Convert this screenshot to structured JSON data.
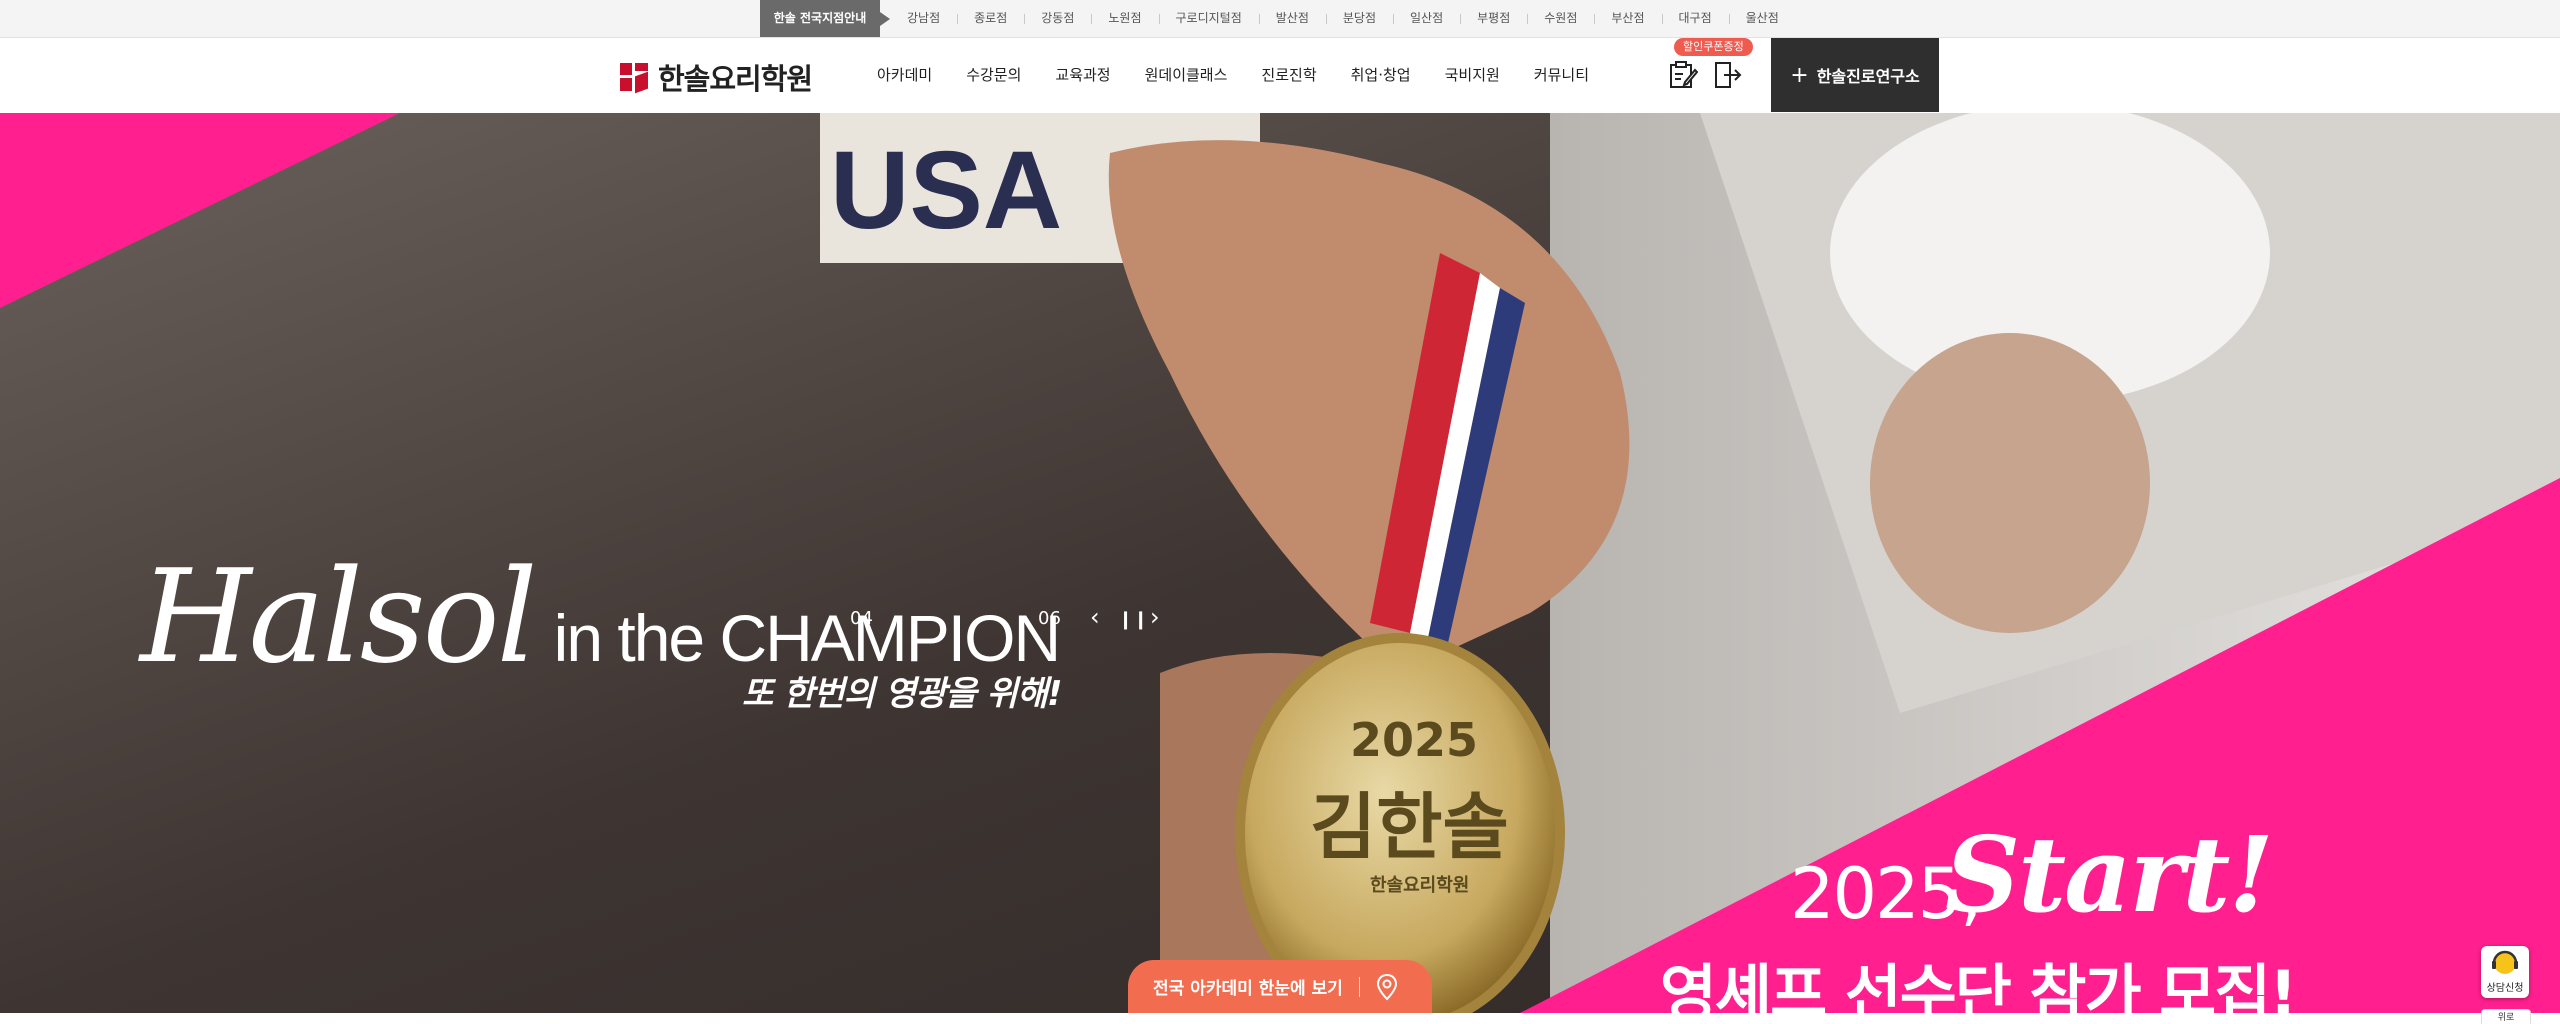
{
  "branch_bar": {
    "guide_label": "한솔 전국지점안내",
    "branches": [
      "강남점",
      "종로점",
      "강동점",
      "노원점",
      "구로디지털점",
      "발산점",
      "분당점",
      "일산점",
      "부평점",
      "수원점",
      "부산점",
      "대구점",
      "울산점"
    ]
  },
  "header": {
    "logo_text": "한솔요리학원",
    "nav": [
      "아카데미",
      "수강문의",
      "교육과정",
      "원데이클래스",
      "진로진학",
      "취업·창업",
      "국비지원",
      "커뮤니티"
    ],
    "coupon_badge": "할인쿠폰증정",
    "lab_button": "한솔진로연구소"
  },
  "hero": {
    "title_script": "Halsol",
    "title_rest": "in the CHAMPION",
    "subtitle": "또 한번의 영광을 위해!",
    "slide_current": "04",
    "slide_total": "06",
    "promo_year": "2025,",
    "promo_start": "Start!",
    "promo_recruit": "영셰프 선수단 참가 모집!",
    "medal_year": "2025",
    "medal_name": "김한솔",
    "medal_academy": "한솔요리학원"
  },
  "map_button": {
    "label": "전국 아카데미 한눈에 보기"
  },
  "consult_widget": {
    "label": "상담신청",
    "sub_label": "위로"
  },
  "colors": {
    "accent_pink": "#ff1f8e",
    "brand_red": "#c8102e",
    "map_orange": "#f26d4f",
    "dark": "#2f2f2f"
  }
}
